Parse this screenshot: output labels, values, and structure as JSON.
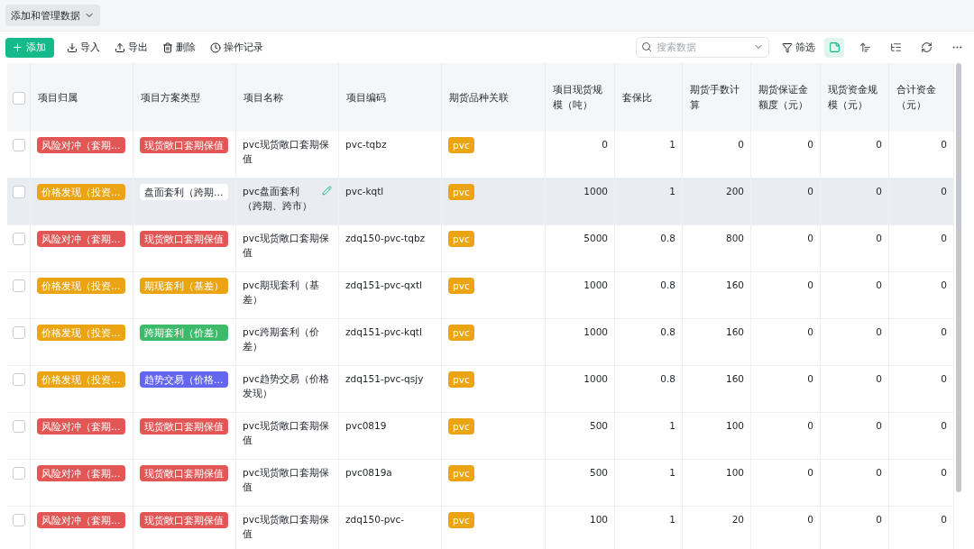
{
  "data_menu": {
    "label": "添加和管理数据"
  },
  "toolbar": {
    "add": "添加",
    "actions": [
      {
        "kind": "import",
        "label": "导入"
      },
      {
        "kind": "export",
        "label": "导出"
      },
      {
        "kind": "delete",
        "label": "删除"
      },
      {
        "kind": "history",
        "label": "操作记录"
      }
    ],
    "search": {
      "placeholder": "搜索数据"
    },
    "filter": "筛选",
    "tools": [
      {
        "kind": "card",
        "selected": true
      },
      {
        "kind": "sort",
        "selected": false
      },
      {
        "kind": "group",
        "selected": false
      },
      {
        "kind": "refresh",
        "selected": false
      },
      {
        "kind": "more",
        "selected": false
      }
    ]
  },
  "table": {
    "select_all": {
      "checked": false
    },
    "columns": [
      "项目归属",
      "项目方案类型",
      "项目名称",
      "项目编码",
      "期货品种关联",
      "项目现货规模（吨）",
      "套保比",
      "期货手数计算",
      "期货保证金额度（元）",
      "现货资金规模（元）",
      "合计资金（元）"
    ],
    "rows": [
      {
        "checked": false,
        "hovered": false,
        "affiliation": {
          "text": "风险对冲（套期…",
          "color": "#e35656"
        },
        "scheme": {
          "text": "现货敞口套期保值",
          "color": "#e35656"
        },
        "name": "pvc现货敞口套期保值",
        "code": "pvc-tqbz",
        "variety": {
          "text": "pvc",
          "color": "#eba514"
        },
        "values": [
          "0",
          "1",
          "0",
          "0",
          "0",
          "0"
        ]
      },
      {
        "checked": false,
        "hovered": true,
        "affiliation": {
          "text": "价格发现（投资…",
          "color": "#eba514"
        },
        "scheme": {
          "text": "盘面套利（跨期…",
          "color": "#ffffff"
        },
        "name": "pvc盘面套利（跨期、跨市）",
        "code": "pvc-kqtl",
        "variety": {
          "text": "pvc",
          "color": "#eba514"
        },
        "values": [
          "1000",
          "1",
          "200",
          "0",
          "0",
          "0"
        ]
      },
      {
        "checked": false,
        "hovered": false,
        "affiliation": {
          "text": "风险对冲（套期…",
          "color": "#e35656"
        },
        "scheme": {
          "text": "现货敞口套期保值",
          "color": "#e35656"
        },
        "name": "pvc现货敞口套期保值",
        "code": "zdq150-pvc-tqbz",
        "variety": {
          "text": "pvc",
          "color": "#eba514"
        },
        "values": [
          "5000",
          "0.8",
          "800",
          "0",
          "0",
          "0"
        ]
      },
      {
        "checked": false,
        "hovered": false,
        "affiliation": {
          "text": "价格发现（投资…",
          "color": "#eba514"
        },
        "scheme": {
          "text": "期现套利（基差）",
          "color": "#eba514"
        },
        "name": "pvc期现套利（基差）",
        "code": "zdq151-pvc-qxtl",
        "variety": {
          "text": "pvc",
          "color": "#eba514"
        },
        "values": [
          "1000",
          "0.8",
          "160",
          "0",
          "0",
          "0"
        ]
      },
      {
        "checked": false,
        "hovered": false,
        "affiliation": {
          "text": "价格发现（投资…",
          "color": "#eba514"
        },
        "scheme": {
          "text": "跨期套利（价差）",
          "color": "#3dbb6a"
        },
        "name": "pvc跨期套利（价差）",
        "code": "zdq151-pvc-kqtl",
        "variety": {
          "text": "pvc",
          "color": "#eba514"
        },
        "values": [
          "1000",
          "0.8",
          "160",
          "0",
          "0",
          "0"
        ]
      },
      {
        "checked": false,
        "hovered": false,
        "affiliation": {
          "text": "价格发现（投资…",
          "color": "#eba514"
        },
        "scheme": {
          "text": "趋势交易（价格…",
          "color": "#6366f1"
        },
        "name": "pvc趋势交易（价格发现）",
        "code": "zdq151-pvc-qsjy",
        "variety": {
          "text": "pvc",
          "color": "#eba514"
        },
        "values": [
          "1000",
          "0.8",
          "160",
          "0",
          "0",
          "0"
        ]
      },
      {
        "checked": false,
        "hovered": false,
        "affiliation": {
          "text": "风险对冲（套期…",
          "color": "#e35656"
        },
        "scheme": {
          "text": "现货敞口套期保值",
          "color": "#e35656"
        },
        "name": "pvc现货敞口套期保值",
        "code": "pvc0819",
        "variety": {
          "text": "pvc",
          "color": "#eba514"
        },
        "values": [
          "500",
          "1",
          "100",
          "0",
          "0",
          "0"
        ]
      },
      {
        "checked": false,
        "hovered": false,
        "affiliation": {
          "text": "风险对冲（套期…",
          "color": "#e35656"
        },
        "scheme": {
          "text": "现货敞口套期保值",
          "color": "#e35656"
        },
        "name": "pvc现货敞口套期保值",
        "code": "pvc0819a",
        "variety": {
          "text": "pvc",
          "color": "#eba514"
        },
        "values": [
          "500",
          "1",
          "100",
          "0",
          "0",
          "0"
        ]
      },
      {
        "checked": false,
        "hovered": false,
        "affiliation": {
          "text": "风险对冲（套期…",
          "color": "#e35656"
        },
        "scheme": {
          "text": "现货敞口套期保值",
          "color": "#e35656"
        },
        "name": "pvc现货敞口套期保值",
        "code": "zdq150-pvc-",
        "variety": {
          "text": "pvc",
          "color": "#eba514"
        },
        "values": [
          "100",
          "1",
          "20",
          "0",
          "0",
          "0"
        ]
      }
    ]
  }
}
